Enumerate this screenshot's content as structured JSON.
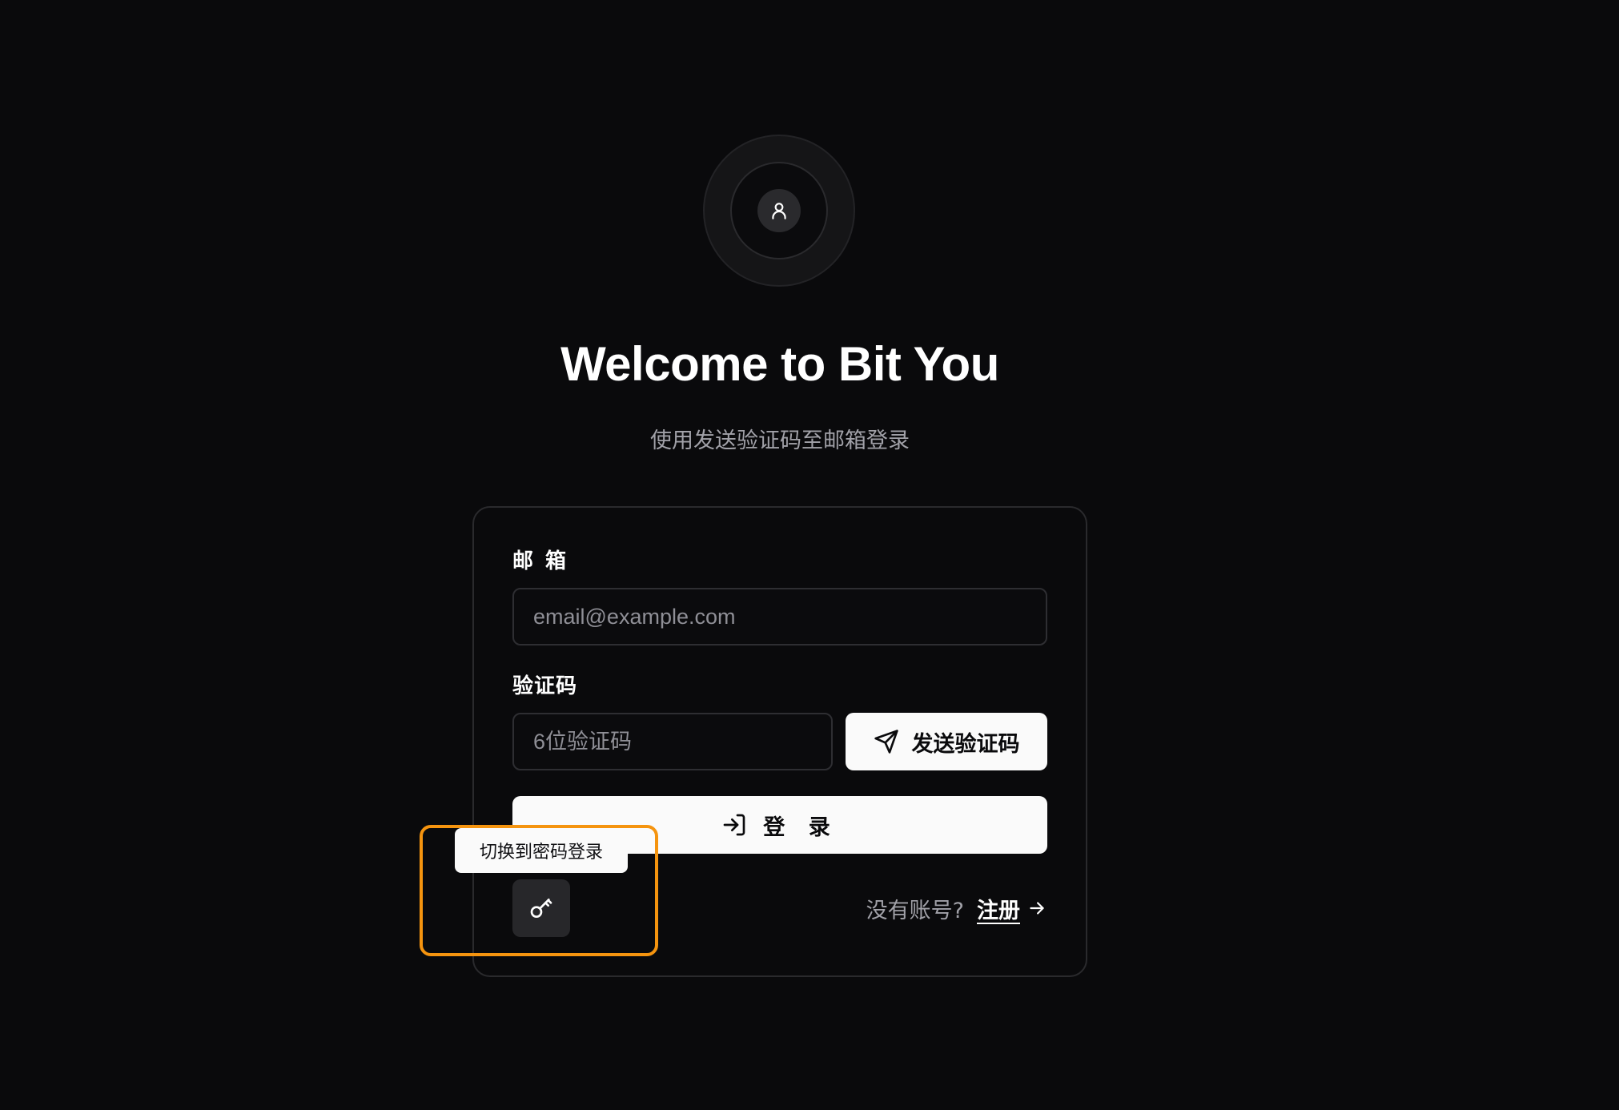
{
  "header": {
    "title": "Welcome to Bit You",
    "subtitle": "使用发送验证码至邮箱登录"
  },
  "form": {
    "email_label": "邮 箱",
    "email_placeholder": "email@example.com",
    "code_label": "验证码",
    "code_placeholder": "6位验证码",
    "send_code_label": "发送验证码",
    "login_label": "登 录"
  },
  "footer": {
    "switch_tooltip": "切换到密码登录",
    "no_account_text": "没有账号?",
    "register_link": "注册"
  },
  "icons": {
    "avatar": "user-icon",
    "send": "send-icon",
    "login": "log-in-icon",
    "switch": "key-icon",
    "register_arrow": "arrow-right-icon"
  },
  "colors": {
    "background": "#0a0a0c",
    "primary_button": "#fafafa",
    "highlight": "#f5940f",
    "muted_text": "#a1a1a8"
  }
}
